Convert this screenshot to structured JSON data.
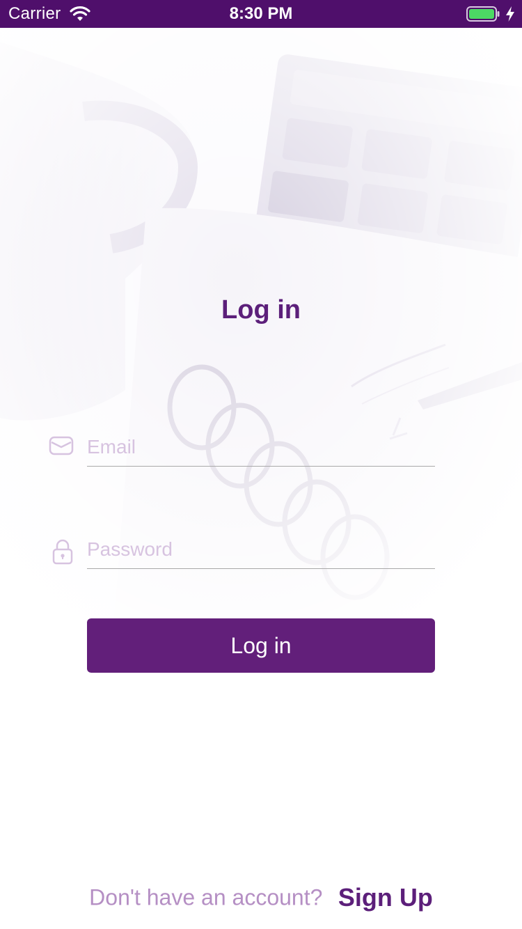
{
  "status_bar": {
    "carrier": "Carrier",
    "time": "8:30 PM",
    "background_color": "#4f0f6b",
    "battery_color": "#4cd964"
  },
  "login": {
    "title": "Log in",
    "email_placeholder": "Email",
    "email_icon": "envelope-icon",
    "password_placeholder": "Password",
    "password_icon": "lock-icon",
    "button_label": "Log in"
  },
  "footer": {
    "prompt": "Don't have an account?",
    "signup_label": "Sign Up"
  },
  "colors": {
    "accent": "#621f7a",
    "placeholder": "#d7c3e0",
    "prompt": "#b58fc4"
  }
}
